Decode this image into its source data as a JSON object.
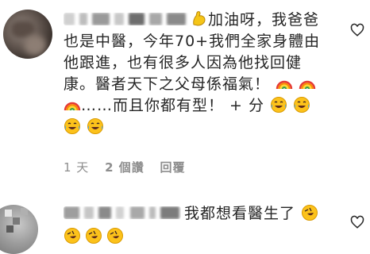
{
  "comments": [
    {
      "text_line1_after_icon": "加油呀，我爸爸",
      "text_line2": "也是中醫，今年70+我們全家身體由",
      "text_line3": "他跟進，也有很多人因為他找回健",
      "text_line4": "康。醫者天下之父母係福氣！",
      "text_line5_after_icon": "……而且你都有型！ + 分",
      "meta": {
        "time": "1 天",
        "likes": "2 個讚",
        "reply": "回覆"
      },
      "icons": {
        "start": "flexed-biceps-icon",
        "rainbow": "rainbow-icon",
        "laugh": "tears-of-joy-icon",
        "like": "heart-outline-icon"
      }
    },
    {
      "text": "我都想看醫生了",
      "icons": {
        "end": "rolling-laughing-icon",
        "like": "heart-outline-icon"
      }
    }
  ],
  "colors": {
    "text": "#262626",
    "meta": "#8e8e8e",
    "background": "#ffffff"
  }
}
